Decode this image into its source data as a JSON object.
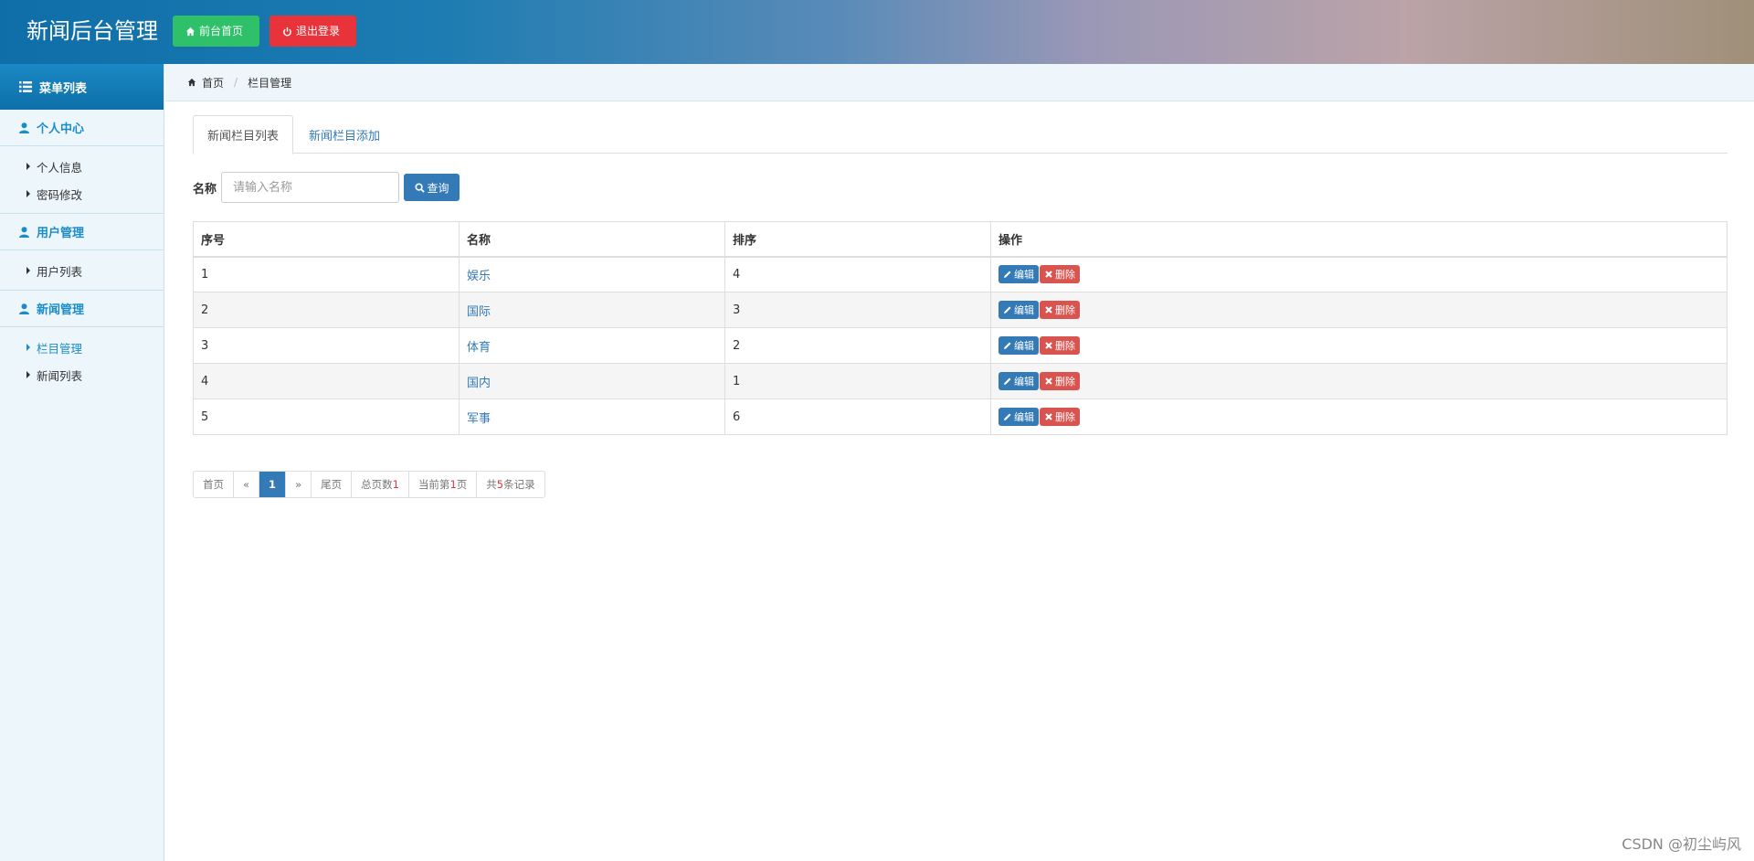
{
  "header": {
    "title": "新闻后台管理",
    "home_button": "前台首页",
    "logout_button": "退出登录",
    "colors": {
      "home": "#2ec16a",
      "logout": "#e8333a"
    }
  },
  "sidebar": {
    "title": "菜单列表",
    "groups": [
      {
        "title": "个人中心",
        "items": [
          {
            "label": "个人信息"
          },
          {
            "label": "密码修改"
          }
        ]
      },
      {
        "title": "用户管理",
        "items": [
          {
            "label": "用户列表"
          }
        ]
      },
      {
        "title": "新闻管理",
        "items": [
          {
            "label": "栏目管理",
            "active": true
          },
          {
            "label": "新闻列表"
          }
        ]
      }
    ]
  },
  "breadcrumb": {
    "home": "首页",
    "current": "栏目管理"
  },
  "tabs": [
    {
      "label": "新闻栏目列表",
      "active": true
    },
    {
      "label": "新闻栏目添加"
    }
  ],
  "search": {
    "label": "名称",
    "placeholder": "请输入名称",
    "button": "查询"
  },
  "table": {
    "headers": [
      "序号",
      "名称",
      "排序",
      "操作"
    ],
    "rows": [
      {
        "id": "1",
        "name": "娱乐",
        "order": "4"
      },
      {
        "id": "2",
        "name": "国际",
        "order": "3"
      },
      {
        "id": "3",
        "name": "体育",
        "order": "2"
      },
      {
        "id": "4",
        "name": "国内",
        "order": "1"
      },
      {
        "id": "5",
        "name": "军事",
        "order": "6"
      }
    ],
    "edit_label": "编辑",
    "delete_label": "删除"
  },
  "pager": {
    "first": "首页",
    "prev": "«",
    "current": "1",
    "next": "»",
    "last": "尾页",
    "total_pages_prefix": "总页数",
    "total_pages": "1",
    "current_page_prefix": "当前第",
    "current_page": "1",
    "current_page_suffix": "页",
    "records_prefix": "共",
    "records": "5",
    "records_suffix": "条记录"
  },
  "watermark": "CSDN @初尘屿风"
}
